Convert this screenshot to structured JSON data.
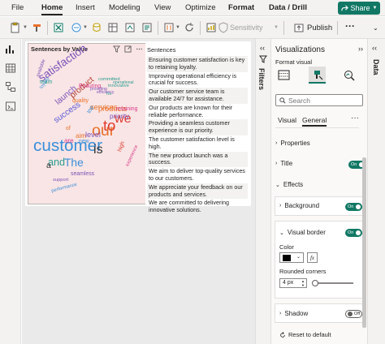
{
  "menu": {
    "items": [
      "File",
      "Home",
      "Insert",
      "Modeling",
      "View",
      "Optimize",
      "Format",
      "Data / Drill"
    ],
    "active": "Home",
    "share_label": "Share"
  },
  "ribbon": {
    "sensitivity_label": "Sensitivity",
    "publish_label": "Publish",
    "more_label": "···"
  },
  "wordcloud": {
    "title": "Sentences by Value",
    "words": [
      {
        "text": "customer",
        "color": "#3a8fd9",
        "size": 18
      },
      {
        "text": "our",
        "color": "#e8702a",
        "size": 17
      },
      {
        "text": "satisfaction",
        "color": "#7b52b8",
        "size": 12
      },
      {
        "text": "to",
        "color": "#e03c31",
        "size": 16
      },
      {
        "text": "we",
        "color": "#e03c31",
        "size": 14
      },
      {
        "text": "The",
        "color": "#3a8fd9",
        "size": 12
      },
      {
        "text": "is",
        "color": "#333333",
        "size": 14
      },
      {
        "text": "product",
        "color": "#b03a2e",
        "size": 9
      },
      {
        "text": "services",
        "color": "#e8702a",
        "size": 8
      },
      {
        "text": "products",
        "color": "#e8702a",
        "size": 8
      },
      {
        "text": "success",
        "color": "#5a5ad6",
        "size": 9
      },
      {
        "text": "and",
        "color": "#2a9d8f",
        "size": 11
      },
      {
        "text": "launch",
        "color": "#7b52b8",
        "size": 9
      },
      {
        "text": "are",
        "color": "#d63a8a",
        "size": 7
      },
      {
        "text": "priority",
        "color": "#7b52b8",
        "size": 7
      },
      {
        "text": "retaining",
        "color": "#d63a8a",
        "size": 6
      },
      {
        "text": "seamless",
        "color": "#7b52b8",
        "size": 6
      },
      {
        "text": "performance",
        "color": "#3a8fd9",
        "size": 5
      },
      {
        "text": "experience",
        "color": "#d63a8a",
        "size": 5
      },
      {
        "text": "quality",
        "color": "#e8702a",
        "size": 6
      },
      {
        "text": "Ensuring",
        "color": "#d63a8a",
        "size": 6
      },
      {
        "text": "committed",
        "color": "#2a9d8f",
        "size": 5
      },
      {
        "text": "level",
        "color": "#7b52b8",
        "size": 8
      },
      {
        "text": "aim",
        "color": "#e8702a",
        "size": 7
      },
      {
        "text": "loyalty",
        "color": "#3a8fd9",
        "size": 5
      },
      {
        "text": "team",
        "color": "#2a9d8f",
        "size": 6
      },
      {
        "text": "available",
        "color": "#7b52b8",
        "size": 5
      },
      {
        "text": "high",
        "color": "#e03c31",
        "size": 6
      },
      {
        "text": "innovative",
        "color": "#2a9d8f",
        "size": 5
      },
      {
        "text": "operational",
        "color": "#2a9d8f",
        "size": 4.5
      },
      {
        "text": "support",
        "color": "#7b52b8",
        "size": 5
      },
      {
        "text": "a",
        "color": "#333333",
        "size": 9
      },
      {
        "text": "new",
        "color": "#3a8fd9",
        "size": 6
      },
      {
        "text": "of",
        "color": "#e8702a",
        "size": 6
      },
      {
        "text": "for",
        "color": "#2a9d8f",
        "size": 5
      },
      {
        "text": "top",
        "color": "#3a8fd9",
        "size": 6
      },
      {
        "text": "efficiency",
        "color": "#7b52b8",
        "size": 4.5
      },
      {
        "text": "providing",
        "color": "#7b52b8",
        "size": 4.5
      }
    ]
  },
  "table": {
    "header": "Sentences",
    "rows": [
      "Ensuring customer satisfaction is key to retaining loyalty.",
      "Improving operational efficiency is crucial for success.",
      "Our customer service team is available 24/7 for assistance.",
      "Our products are known for their reliable performance.",
      "Providing a seamless customer experience is our priority.",
      "The customer satisfaction level is high.",
      "The new product launch was a success.",
      "We aim to deliver top-quality services to our customers.",
      "We appreciate your feedback on our products and services.",
      "We are committed to delivering innovative solutions."
    ]
  },
  "filters": {
    "label": "Filters"
  },
  "data_pane": {
    "label": "Data"
  },
  "visualizations": {
    "title": "Visualizations",
    "format_visual_label": "Format visual",
    "search_placeholder": "Search",
    "tabs": [
      "Visual",
      "General"
    ],
    "active_tab": "General",
    "more": "···",
    "sections": {
      "properties": "Properties",
      "title": "Title",
      "effects": "Effects",
      "background": "Background",
      "visual_border": "Visual border",
      "shadow": "Shadow"
    },
    "toggles": {
      "title": "On",
      "background": "On",
      "visual_border": "On",
      "shadow": "Off"
    },
    "color_label": "Color",
    "color_value": "#000000",
    "fx_label": "fx",
    "rounded_corners_label": "Rounded corners",
    "rounded_corners_value": "4 px",
    "rounded_corners_level": 0.05,
    "reset_label": "Reset to default"
  }
}
